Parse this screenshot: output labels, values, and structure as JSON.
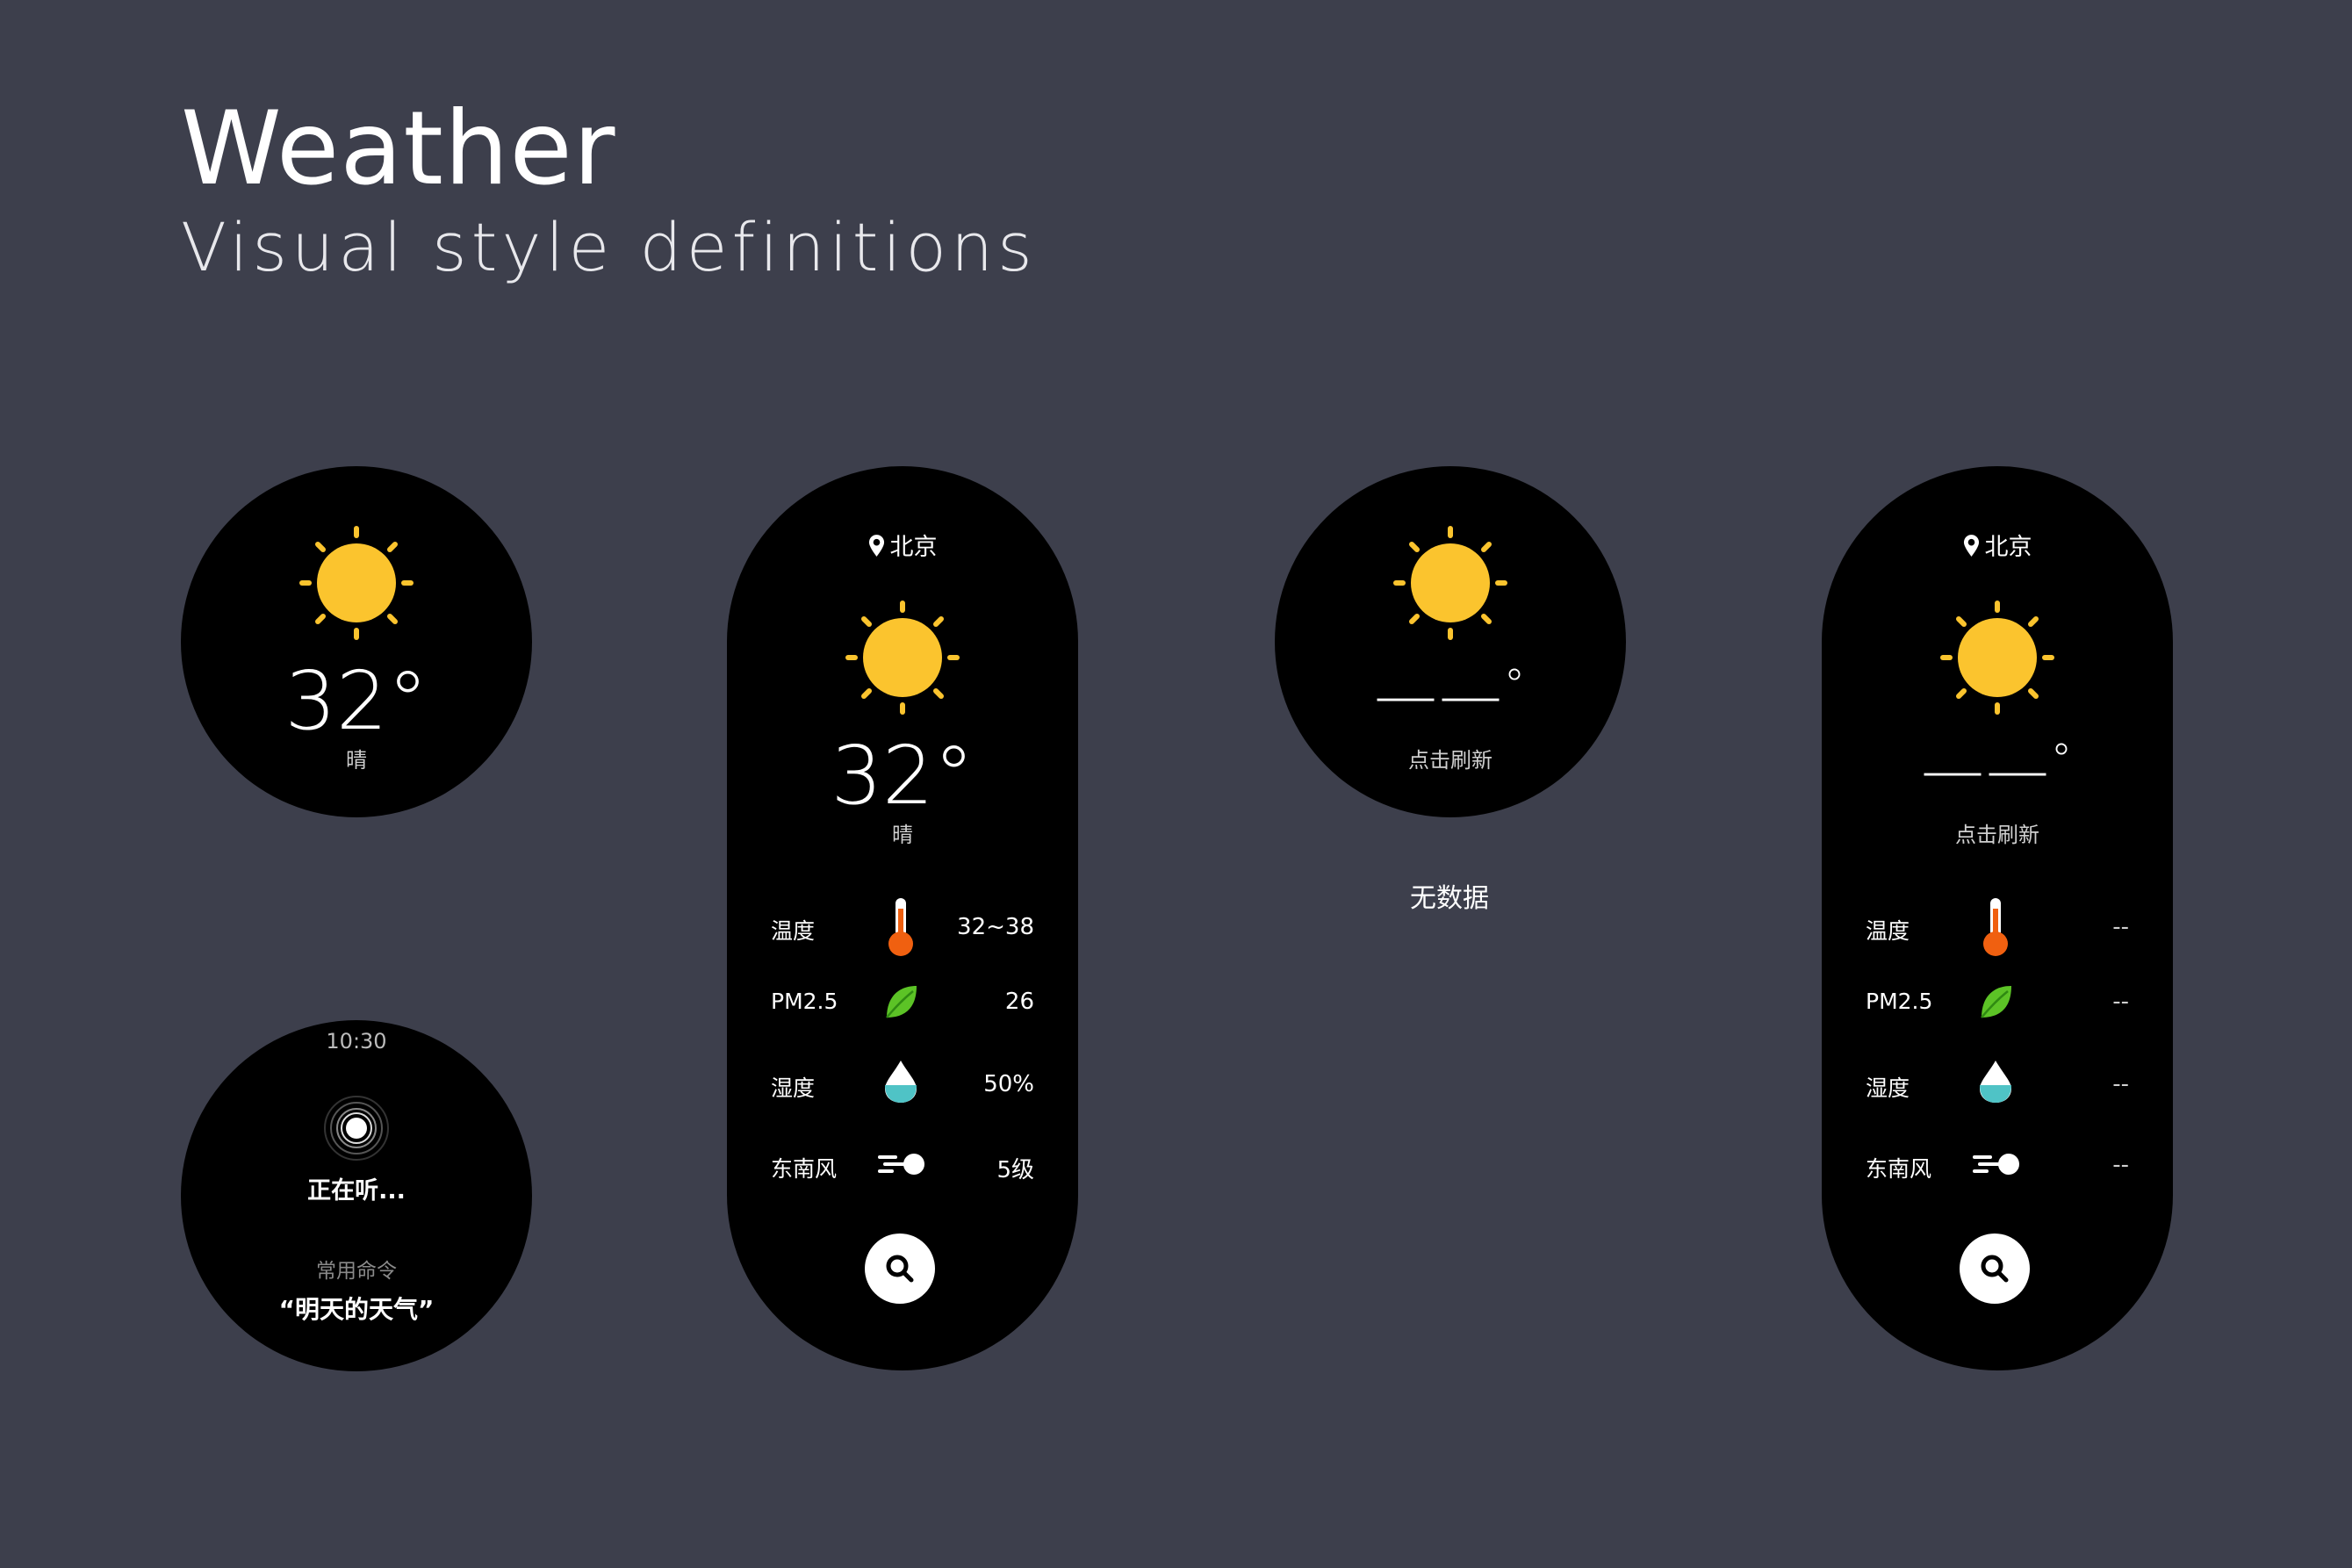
{
  "header": {
    "title": "Weather",
    "subtitle": "Visual style definitions"
  },
  "colors": {
    "background": "#3d3f4c",
    "device": "#000000",
    "sun": "#fbc42e",
    "thermometer": "#f06010",
    "leaf": "#5cc326",
    "drop": "#4fc3c6"
  },
  "round_weather": {
    "temperature": "32°",
    "condition": "晴"
  },
  "round_listening": {
    "time": "10:30",
    "status": "正在听...",
    "command_label": "常用命令",
    "command_text": "“明天的天气”"
  },
  "pill_weather": {
    "location": "北京",
    "temperature": "32°",
    "condition": "晴",
    "rows": [
      {
        "label": "温度",
        "icon": "thermometer-icon",
        "value": "32~38"
      },
      {
        "label": "PM2.5",
        "icon": "leaf-icon",
        "value": "26"
      },
      {
        "label": "湿度",
        "icon": "water-drop-icon",
        "value": "50%"
      },
      {
        "label": "东南风",
        "icon": "wind-icon",
        "value": "5级"
      }
    ],
    "search_icon": "search-icon"
  },
  "round_nodata": {
    "temperature": "——",
    "degree": "°",
    "hint": "点击刷新",
    "caption": "无数据"
  },
  "pill_nodata": {
    "location": "北京",
    "temperature": "——",
    "degree": "°",
    "hint": "点击刷新",
    "rows": [
      {
        "label": "温度",
        "icon": "thermometer-icon",
        "value": "--"
      },
      {
        "label": "PM2.5",
        "icon": "leaf-icon",
        "value": "--"
      },
      {
        "label": "湿度",
        "icon": "water-drop-icon",
        "value": "--"
      },
      {
        "label": "东南风",
        "icon": "wind-icon",
        "value": "--"
      }
    ],
    "search_icon": "search-icon"
  }
}
